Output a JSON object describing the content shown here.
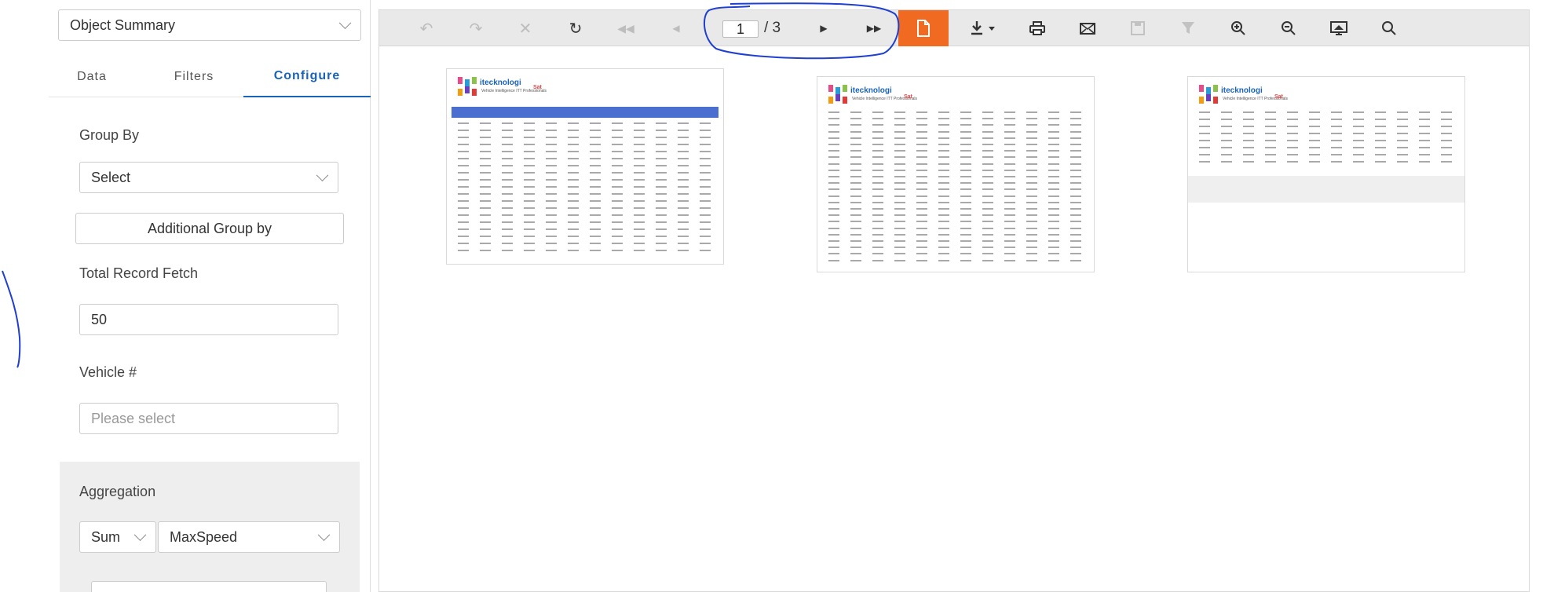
{
  "left_panel": {
    "object_dropdown": "Object Summary",
    "tabs": [
      {
        "label": "Data"
      },
      {
        "label": "Filters"
      },
      {
        "label": "Configure"
      }
    ],
    "group_by": {
      "label": "Group By",
      "value": "Select"
    },
    "additional_group_by": "Additional Group by",
    "total_record_fetch": {
      "label": "Total Record Fetch",
      "value": "50"
    },
    "vehicle": {
      "label": "Vehicle #",
      "placeholder": "Please select"
    },
    "aggregation": {
      "label": "Aggregation",
      "function": "Sum",
      "field": "MaxSpeed"
    }
  },
  "viewer": {
    "toolbar": {
      "page_current": "1",
      "page_total": "/ 3",
      "accent_color": "#f16a22"
    },
    "pages": [
      {
        "logo": "itecknologi",
        "sub": "Vehicle Intelligence ITT Professionals",
        "sat": "Sat"
      },
      {
        "logo": "itecknologi",
        "sub": "Vehicle Intelligence ITT Professionals",
        "sat": "Sat"
      },
      {
        "logo": "itecknologi",
        "sub": "Vehicle Intelligence ITT Professionals",
        "sat": "Sat"
      }
    ]
  }
}
